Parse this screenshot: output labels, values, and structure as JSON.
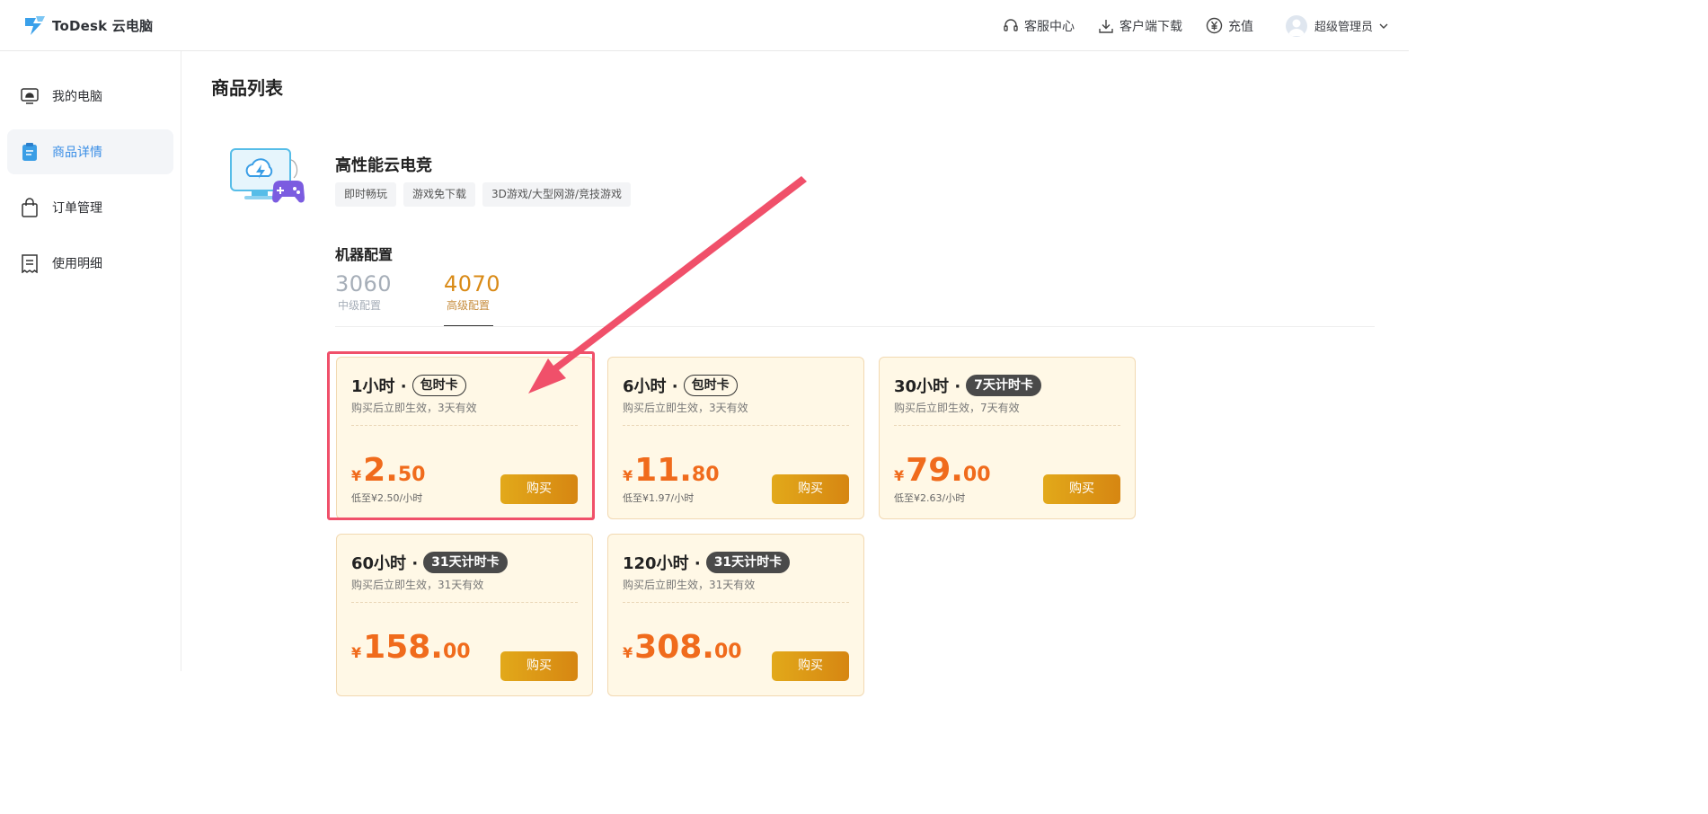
{
  "app": {
    "logo_text": "ToDesk 云电脑",
    "brand_color": "#3a9ee6"
  },
  "top_nav": {
    "support": "客服中心",
    "download": "客户端下载",
    "recharge": "充值",
    "user": "超级管理员"
  },
  "sidebar": {
    "items": [
      {
        "label": "我的电脑",
        "icon": "monitor-icon"
      },
      {
        "label": "商品详情",
        "icon": "clipboard-icon",
        "active": true
      },
      {
        "label": "订单管理",
        "icon": "shopping-bag-icon"
      },
      {
        "label": "使用明细",
        "icon": "receipt-icon"
      }
    ]
  },
  "main": {
    "title": "商品列表",
    "product": {
      "name": "高性能云电竞",
      "tags": [
        "即时畅玩",
        "游戏免下载",
        "3D游戏/大型网游/竞技游戏"
      ]
    },
    "config": {
      "title": "机器配置",
      "tabs": [
        {
          "model": "3060",
          "level": "中级配置",
          "active": false
        },
        {
          "model": "4070",
          "level": "高级配置",
          "active": true
        }
      ]
    },
    "cards": [
      {
        "hours": "1小时 ·",
        "badge": "包时卡",
        "badge_style": "outline",
        "desc": "购买后立即生效，3天有效",
        "currency": "¥",
        "price_int": "2.",
        "price_dec": "50",
        "note": "低至¥2.50/小时",
        "button": "购买",
        "highlighted": true
      },
      {
        "hours": "6小时 ·",
        "badge": "包时卡",
        "badge_style": "outline",
        "desc": "购买后立即生效，3天有效",
        "currency": "¥",
        "price_int": "11.",
        "price_dec": "80",
        "note": "低至¥1.97/小时",
        "button": "购买"
      },
      {
        "hours": "30小时 ·",
        "badge": "7天计时卡",
        "badge_style": "dark",
        "desc": "购买后立即生效，7天有效",
        "currency": "¥",
        "price_int": "79.",
        "price_dec": "00",
        "note": "低至¥2.63/小时",
        "button": "购买"
      },
      {
        "hours": "60小时 ·",
        "badge": "31天计时卡",
        "badge_style": "dark",
        "desc": "购买后立即生效，31天有效",
        "currency": "¥",
        "price_int": "158.",
        "price_dec": "00",
        "note": "",
        "button": "购买"
      },
      {
        "hours": "120小时 ·",
        "badge": "31天计时卡",
        "badge_style": "dark",
        "desc": "购买后立即生效，31天有效",
        "currency": "¥",
        "price_int": "308.",
        "price_dec": "00",
        "note": "",
        "button": "购买"
      }
    ]
  },
  "colors": {
    "price": "#f06b1c",
    "card_bg": "#fff8e6",
    "highlight": "#f0506a",
    "active_tab": "#d98a16"
  }
}
